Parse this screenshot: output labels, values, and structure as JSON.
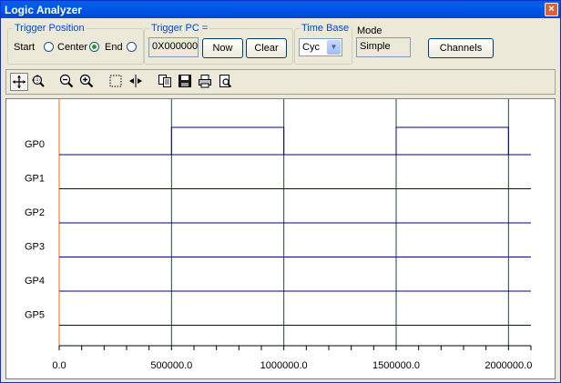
{
  "window": {
    "title": "Logic Analyzer",
    "close_glyph": "×"
  },
  "trigger_position": {
    "legend": "Trigger Position",
    "options": [
      {
        "label": "Start",
        "selected": false
      },
      {
        "label": "Center",
        "selected": true
      },
      {
        "label": "End",
        "selected": false
      }
    ]
  },
  "trigger_pc": {
    "legend": "Trigger PC =",
    "value": "0X000000",
    "now_label": "Now",
    "clear_label": "Clear"
  },
  "time_base": {
    "legend": "Time Base",
    "value": "Cyc"
  },
  "mode": {
    "label": "Mode",
    "value": "Simple"
  },
  "channels_label": "Channels",
  "toolbar": {
    "buttons": [
      {
        "icon": "pan-icon",
        "pressed": true
      },
      {
        "icon": "zoom-region-icon",
        "pressed": false
      },
      {
        "icon": "zoom-out-icon",
        "pressed": false
      },
      {
        "icon": "zoom-in-icon",
        "pressed": false
      },
      {
        "icon": "select-region-icon",
        "pressed": false
      },
      {
        "icon": "marker-icon",
        "pressed": false
      },
      {
        "icon": "copy-icon",
        "pressed": false
      },
      {
        "icon": "save-icon",
        "pressed": false
      },
      {
        "icon": "print-icon",
        "pressed": false
      },
      {
        "icon": "print-preview-icon",
        "pressed": false
      }
    ]
  },
  "chart_data": {
    "type": "line",
    "channels": [
      "GP0",
      "GP1",
      "GP2",
      "GP3",
      "GP4",
      "GP5"
    ],
    "xlim": [
      0,
      2100000
    ],
    "x_ticks": [
      0,
      500000,
      1000000,
      1500000,
      2000000
    ],
    "x_tick_labels": [
      "0.0",
      "500000.0",
      "1000000.0",
      "1500000.0",
      "2000000.0"
    ],
    "minor_tick_step": 100000,
    "signals": [
      {
        "name": "GP0",
        "transitions": [
          [
            0,
            0
          ],
          [
            500000,
            1
          ],
          [
            1000000,
            0
          ],
          [
            1500000,
            1
          ],
          [
            2000000,
            0
          ]
        ]
      },
      {
        "name": "GP1",
        "transitions": [
          [
            0,
            0
          ]
        ]
      },
      {
        "name": "GP2",
        "transitions": [
          [
            0,
            0
          ]
        ]
      },
      {
        "name": "GP3",
        "transitions": [
          [
            0,
            0
          ]
        ]
      },
      {
        "name": "GP4",
        "transitions": [
          [
            0,
            0
          ]
        ]
      },
      {
        "name": "GP5",
        "transitions": [
          [
            0,
            0
          ]
        ]
      }
    ],
    "colors": {
      "signal": "#00008b",
      "marker": "#1e4a36",
      "origin": "#ff6600",
      "separator": "#00008b"
    }
  }
}
